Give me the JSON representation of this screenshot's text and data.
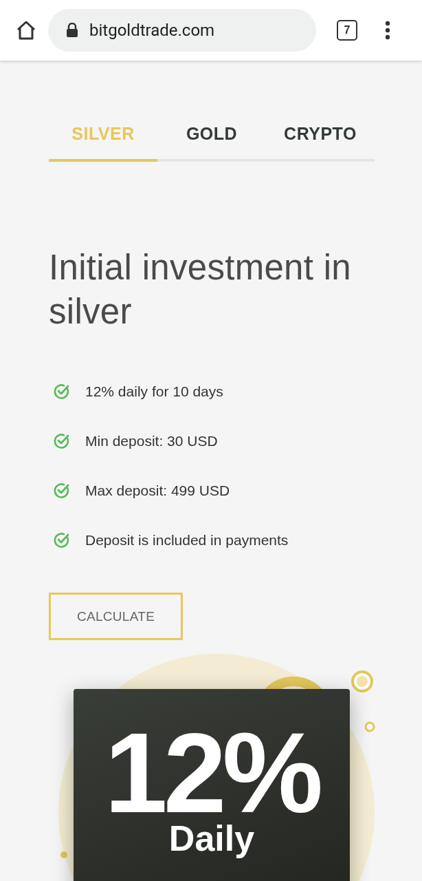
{
  "browser": {
    "url": "bitgoldtrade.com",
    "tab_count": "7"
  },
  "tabs": [
    {
      "label": "SILVER",
      "selected": true
    },
    {
      "label": "GOLD",
      "selected": false
    },
    {
      "label": "CRYPTO",
      "selected": false
    }
  ],
  "heading": "Initial investment in silver",
  "features": [
    "12% daily for 10 days",
    "Min deposit: 30 USD",
    "Max deposit: 499 USD",
    "Deposit is included in payments"
  ],
  "button": "CALCULATE",
  "promo": {
    "rate": "12%",
    "period": "Daily"
  }
}
